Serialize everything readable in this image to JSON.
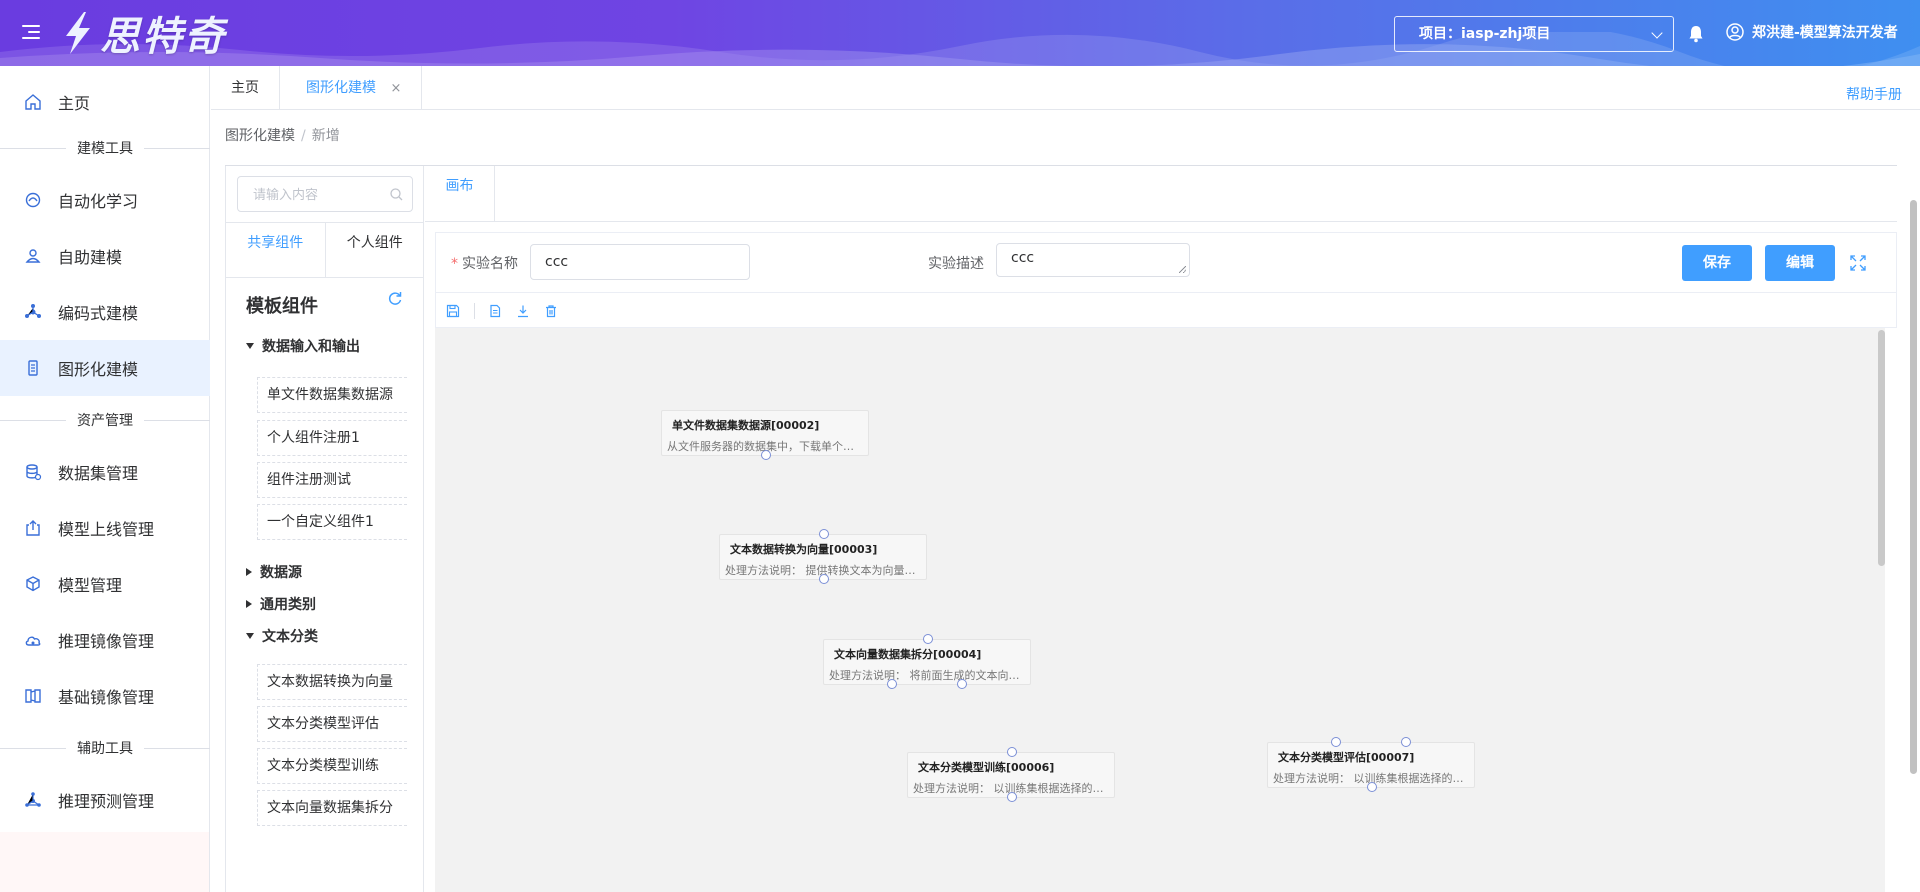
{
  "header": {
    "logo_text": "思特奇",
    "project_label": "项目：iasp-zhj项目",
    "user_name": "郑洪建-模型算法开发者"
  },
  "sidebar": {
    "home": "主页",
    "group_modeling": "建模工具",
    "items_modeling": [
      "自动化学习",
      "自助建模",
      "编码式建模",
      "图形化建模"
    ],
    "group_assets": "资产管理",
    "items_assets": [
      "数据集管理",
      "模型上线管理",
      "模型管理",
      "推理镜像管理",
      "基础镜像管理"
    ],
    "group_aux": "辅助工具",
    "items_aux": [
      "推理预测管理"
    ]
  },
  "tabs": [
    {
      "label": "主页"
    },
    {
      "label": "图形化建模",
      "close": "×"
    }
  ],
  "help_link": "帮助手册",
  "breadcrumb": {
    "parent": "图形化建模",
    "sep": "/",
    "current": "新增"
  },
  "components": {
    "search_placeholder": "请输入内容",
    "tabs": [
      "共享组件",
      "个人组件"
    ],
    "title": "模板组件",
    "groups": [
      {
        "name": "数据输入和输出",
        "items": [
          "单文件数据集数据源",
          "个人组件注册1",
          "组件注册测试",
          "一个自定义组件1"
        ]
      },
      {
        "name": "数据源"
      },
      {
        "name": "通用类别"
      },
      {
        "name": "文本分类",
        "items": [
          "文本数据转换为向量",
          "文本分类模型评估",
          "文本分类模型训练",
          "文本向量数据集拆分"
        ]
      }
    ]
  },
  "canvas_tab": "画布",
  "form": {
    "required_mark": "*",
    "name_label": "实验名称",
    "name_value": "ccc",
    "desc_label": "实验描述",
    "desc_value": "ccc",
    "save_button": "保存",
    "edit_button": "编辑"
  },
  "nodes": [
    {
      "title": "单文件数据集数据源[00002]",
      "desc": "从文件服务器的数据集中，下载单个文件作为数据源"
    },
    {
      "title": "文本数据转换为向量[00003]",
      "desc": "处理方法说明：  提供转换文本为向量的方法"
    },
    {
      "title": "文本向量数据集拆分[00004]",
      "desc": "处理方法说明：  将前面生成的文本向量拆分"
    },
    {
      "title": "文本分类模型训练[00006]",
      "desc": "处理方法说明：  以训练集根据选择的算法训练"
    },
    {
      "title": "文本分类模型评估[00007]",
      "desc": "处理方法说明：  以训练集根据选择的算法评估"
    }
  ],
  "colors": {
    "primary": "#409eff",
    "header_start": "#6a3ce0",
    "header_end": "#3f8ff0",
    "active_nav_bg": "#e9f2ff"
  }
}
